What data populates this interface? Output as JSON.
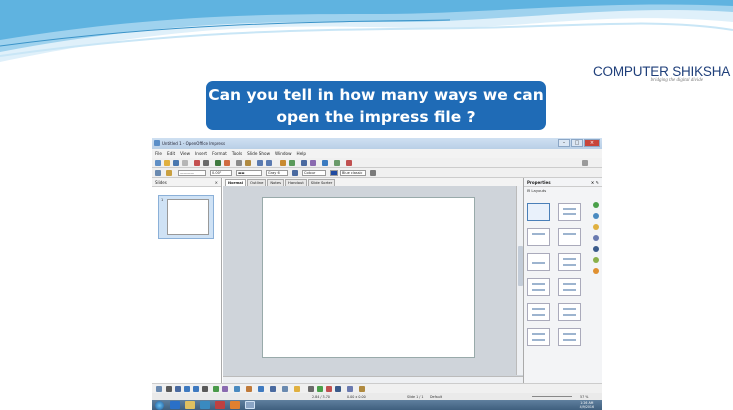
{
  "logo": {
    "main": "COMPUTER SHIKSHA",
    "tagline": "bridging the digital divide"
  },
  "question": {
    "line1": "Can you tell in how many ways we can",
    "line2": "open the impress file ?"
  },
  "window": {
    "title": "Untitled 1 - OpenOffice Impress",
    "menu": [
      "File",
      "Edit",
      "View",
      "Insert",
      "Format",
      "Tools",
      "Slide Show",
      "Window",
      "Help"
    ],
    "toolbar2": {
      "line_width": "0.00\"",
      "area_style": "Gray 6",
      "color_label": "Colour",
      "color_name": "Blue classic"
    },
    "slides_pane_title": "Slides",
    "slide_number": "1",
    "tabs": [
      "Normal",
      "Outline",
      "Notes",
      "Handout",
      "Slide Sorter"
    ],
    "properties_title": "Properties",
    "layouts_label": "Layouts",
    "status": {
      "position": "2.84 / 3.70",
      "size": "0.00 x 0.00",
      "slide": "Slide 1 / 1",
      "layout": "Default",
      "zoom": "57 %"
    },
    "clock": {
      "time": "1:26 AM",
      "date": "4/9/2016"
    }
  },
  "colors": {
    "question_bg": "#1f6bb6",
    "logo_text": "#1f3f7a",
    "wave": "#5fb3e0"
  }
}
